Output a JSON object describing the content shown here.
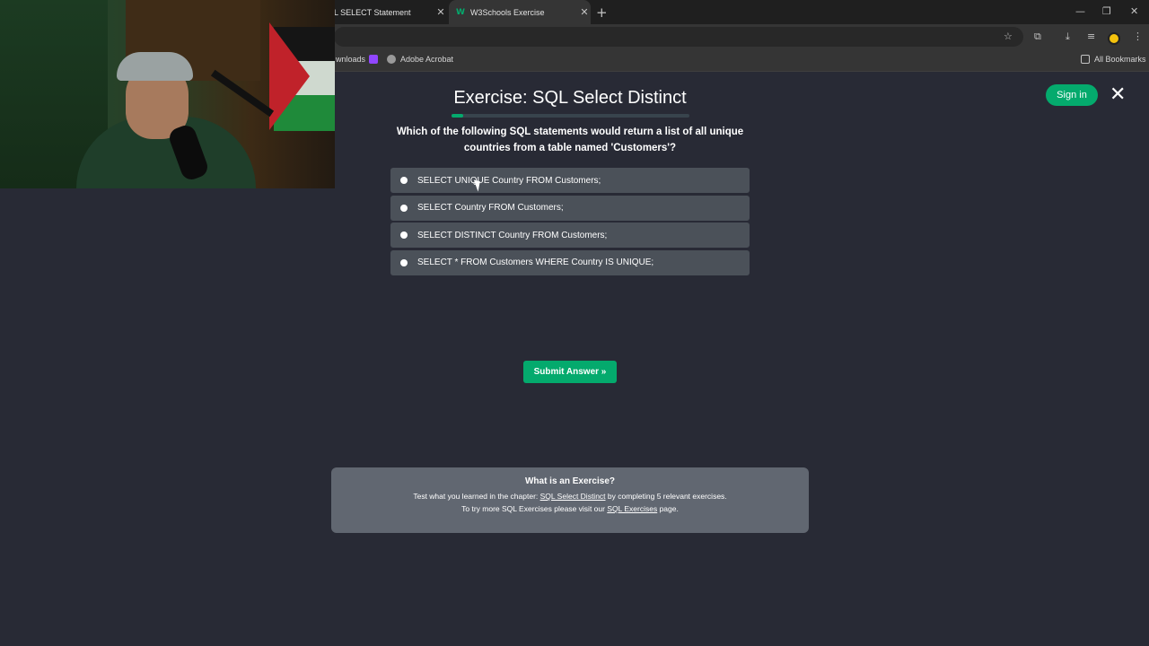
{
  "browser": {
    "tabs": [
      {
        "label": "L SELECT Statement",
        "active": false
      },
      {
        "label": "W3Schools Exercise",
        "active": true
      }
    ],
    "new_tab_icon": "plus-icon",
    "bookmarks": [
      {
        "label": "wnloads"
      },
      {
        "label": ""
      },
      {
        "label": "Adobe Acrobat"
      }
    ],
    "all_bookmarks_label": "All Bookmarks"
  },
  "page": {
    "title": "Exercise: SQL Select Distinct",
    "progress": 0.05,
    "sign_in_label": "Sign in",
    "close_label": "✕",
    "question": "Which of the following SQL statements would return a list of all unique countries from a table named 'Customers'?",
    "options": [
      "SELECT UNIQUE Country FROM Customers;",
      "SELECT Country FROM Customers;",
      "SELECT DISTINCT Country FROM Customers;",
      "SELECT * FROM Customers WHERE Country IS UNIQUE;"
    ],
    "submit_label": "Submit Answer »"
  },
  "info": {
    "title": "What is an Exercise?",
    "line1_prefix": "Test what you learned in the chapter: ",
    "line1_link": "SQL Select Distinct",
    "line1_suffix": " by completing 5 relevant exercises.",
    "line2_prefix": "To try more SQL Exercises please visit our ",
    "line2_link": "SQL Exercises",
    "line2_suffix": " page."
  },
  "colors": {
    "accent": "#04aa6d",
    "background": "#282a35",
    "option_bg": "#4b5159",
    "info_bg": "#616771"
  }
}
